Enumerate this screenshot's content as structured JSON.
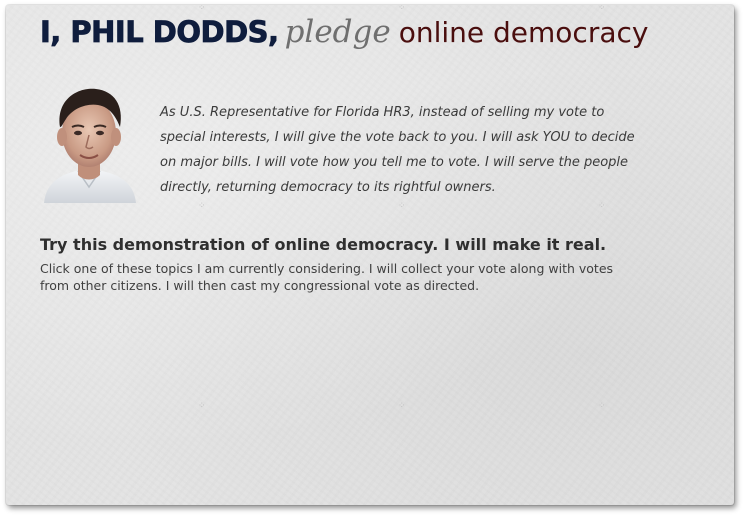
{
  "header": {
    "name": "I, PHIL DODDS,",
    "pledge_word": "pledge",
    "tagline": "online democracy"
  },
  "portrait": {
    "icon": "candidate-photo"
  },
  "pledge": {
    "text": "As U.S. Representative for Florida HR3, instead of selling my vote to special interests, I will give the vote back to you. I will ask YOU to decide on major bills. I will vote how you tell me to vote. I will serve the  people directly, returning democracy to its rightful owners."
  },
  "demo": {
    "title": "Try this demonstration of online democracy. I will make it real.",
    "description": "Click one of these topics I am currently considering. I will collect your vote along with votes from other citizens. I will then cast my congressional vote as directed."
  },
  "colors": {
    "name": "#0f1d3d",
    "pledge_word": "#6f6f6f",
    "tagline": "#4a0e0e",
    "paper": "#e4e4e4"
  }
}
